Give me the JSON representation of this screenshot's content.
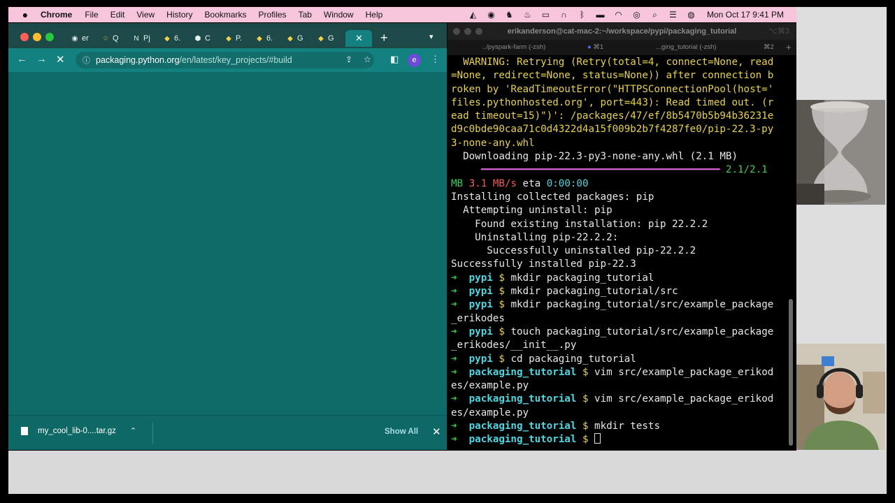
{
  "menubar": {
    "app_name": "Chrome",
    "menus": [
      "File",
      "Edit",
      "View",
      "History",
      "Bookmarks",
      "Profiles",
      "Tab",
      "Window",
      "Help"
    ],
    "clock": "Mon Oct 17  9:41 PM"
  },
  "browser": {
    "tabs": [
      {
        "label": "er",
        "icon": "github-icon"
      },
      {
        "label": "Q",
        "icon": "star-icon"
      },
      {
        "label": "Pj",
        "icon": "notion-icon"
      },
      {
        "label": "6.",
        "icon": "python-icon"
      },
      {
        "label": "C",
        "icon": "hexagon-icon"
      },
      {
        "label": "P.",
        "icon": "python-icon"
      },
      {
        "label": "6.",
        "icon": "python-icon"
      },
      {
        "label": "G",
        "icon": "python-icon"
      },
      {
        "label": "G",
        "icon": "python-icon"
      }
    ],
    "url_host": "packaging.python.org",
    "url_path": "/en/latest/key_projects/#build",
    "profile_letter": "e",
    "download": {
      "filename": "my_cool_lib-0....tar.gz",
      "show_all": "Show All"
    }
  },
  "terminal": {
    "title": "erikanderson@cat-mac-2:~/workspace/pypi/packaging_tutorial",
    "shortcut": "⌥⌘3",
    "tabs": [
      {
        "label": "../pyspark-farm (-zsh)",
        "shortcut": "⌘1"
      },
      {
        "label": "...ging_tutorial (-zsh)",
        "shortcut": "⌘2"
      }
    ],
    "warning_lines": [
      "  WARNING: Retrying (Retry(total=4, connect=None, read",
      "=None, redirect=None, status=None)) after connection b",
      "roken by 'ReadTimeoutError(\"HTTPSConnectionPool(host='",
      "files.pythonhosted.org', port=443): Read timed out. (r",
      "ead timeout=15)\")': /packages/47/ef/8b5470b5b94b36231e",
      "d9c0bde90caa71c0d4322d4a15f009b2b7f4287fe0/pip-22.3-py",
      "3-none-any.whl"
    ],
    "downloading": "  Downloading pip-22.3-py3-none-any.whl (2.1 MB)",
    "progress_count": "2.1/2.1",
    "progress_unit": "MB",
    "progress_speed": "3.1 MB/s",
    "progress_eta_label": "eta",
    "progress_eta": "0:00:00",
    "install_lines": [
      "Installing collected packages: pip",
      "  Attempting uninstall: pip",
      "    Found existing installation: pip 22.2.2",
      "    Uninstalling pip-22.2.2:",
      "      Successfully uninstalled pip-22.2.2",
      "Successfully installed pip-22.3"
    ],
    "commands": [
      {
        "dir": "pypi",
        "cmd": "mkdir packaging_tutorial"
      },
      {
        "dir": "pypi",
        "cmd": "mkdir packaging_tutorial/src"
      },
      {
        "dir": "pypi",
        "cmd": "mkdir packaging_tutorial/src/example_package",
        "cont": "_erikodes"
      },
      {
        "dir": "pypi",
        "cmd": "touch packaging_tutorial/src/example_package",
        "cont": "_erikodes/__init__.py"
      },
      {
        "dir": "pypi",
        "cmd": "cd packaging_tutorial"
      },
      {
        "dir": "packaging_tutorial",
        "cmd": "vim src/example_package_erikod",
        "cont": "es/example.py"
      },
      {
        "dir": "packaging_tutorial",
        "cmd": "vim src/example_package_erikod",
        "cont": "es/example.py"
      },
      {
        "dir": "packaging_tutorial",
        "cmd": "mkdir tests"
      },
      {
        "dir": "packaging_tutorial",
        "cmd": ""
      }
    ],
    "prompt_arrow": "➜",
    "prompt_dollar": "$"
  },
  "colors": {
    "menubar_bg": "#f7c6dc",
    "browser_accent": "#13817f",
    "terminal_bg": "#000000"
  }
}
